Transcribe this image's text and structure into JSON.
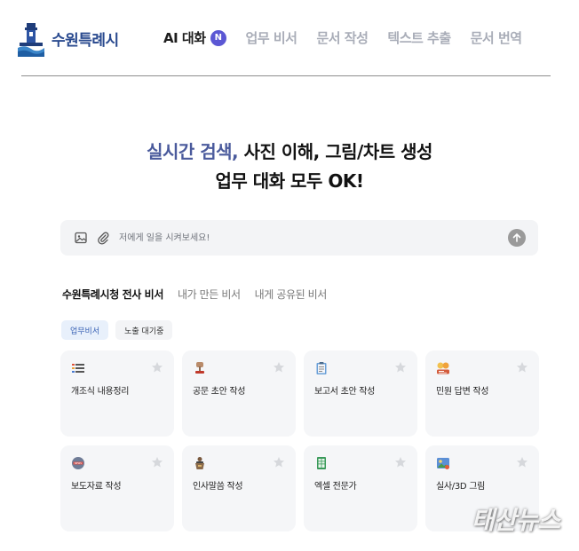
{
  "header": {
    "logo_text": "수원특례시",
    "nav": [
      {
        "label": "AI 대화",
        "badge": "N",
        "active": true
      },
      {
        "label": "업무 비서"
      },
      {
        "label": "문서 작성"
      },
      {
        "label": "텍스트 추출"
      },
      {
        "label": "문서 번역"
      }
    ]
  },
  "hero": {
    "line1_accent": "실시간 검색,",
    "line1_rest": " 사진 이해, 그림/차트 생성",
    "line2": "업무 대화 모두 OK!"
  },
  "prompt": {
    "placeholder": "저에게 일을 시켜보세요!",
    "value": "",
    "icons": [
      "image-icon",
      "paperclip-icon",
      "send-icon"
    ]
  },
  "tabs": [
    {
      "label": "수원특례시청 전사 비서",
      "active": true
    },
    {
      "label": "내가 만든 비서"
    },
    {
      "label": "내게 공유된 비서"
    }
  ],
  "chips": [
    {
      "label": "업무비서",
      "active": true
    },
    {
      "label": "노출 대기중"
    }
  ],
  "cards": [
    {
      "label": "개조식 내용정리",
      "icon": "list-icon"
    },
    {
      "label": "공문 초안 작성",
      "icon": "stamp-icon"
    },
    {
      "label": "보고서 초안 작성",
      "icon": "clipboard-icon"
    },
    {
      "label": "민원 답변 작성",
      "icon": "chat-people-icon"
    },
    {
      "label": "보도자료 작성",
      "icon": "news-icon"
    },
    {
      "label": "인사말씀 작성",
      "icon": "podium-icon"
    },
    {
      "label": "엑셀 전문가",
      "icon": "spreadsheet-icon"
    },
    {
      "label": "실사/3D 그림",
      "icon": "picture-icon"
    }
  ],
  "watermark": "태산뉴스",
  "colors": {
    "accent": "#4a5a9c",
    "badge": "#5b57d4",
    "brand": "#2a4a8f",
    "card_bg": "#f5f6f8"
  }
}
